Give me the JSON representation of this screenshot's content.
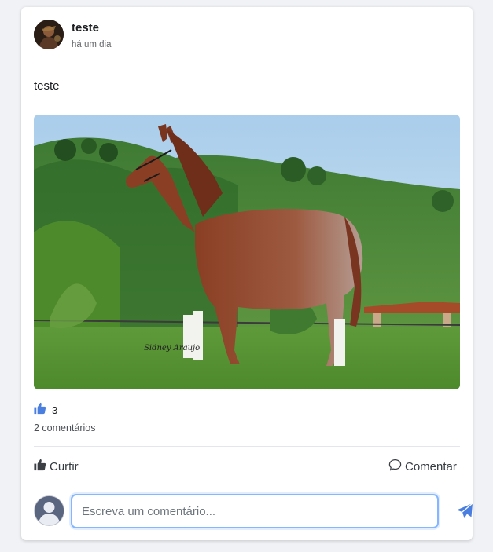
{
  "colors": {
    "accent": "#4a7fe0",
    "divider": "#e4e6eb"
  },
  "post": {
    "author": "teste",
    "time": "há um dia",
    "text": "teste",
    "image_alt": "horse photo",
    "likes_count": "3",
    "comments_count": "2 comentários"
  },
  "actions": {
    "like_label": "Curtir",
    "comment_label": "Comentar"
  },
  "comment_box": {
    "placeholder": "Escreva um comentário...",
    "value": ""
  },
  "icons": {
    "like": "thumbs-up-icon",
    "comment": "speech-bubble-icon",
    "send": "paper-plane-icon"
  }
}
